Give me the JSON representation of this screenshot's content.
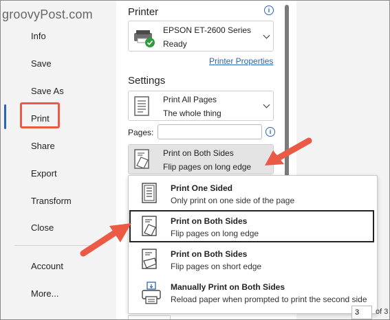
{
  "watermark": "groovyPost.com",
  "nav": {
    "items": [
      "Info",
      "Save",
      "Save As",
      "Print",
      "Share",
      "Export",
      "Transform",
      "Close",
      "Account",
      "More..."
    ],
    "active": "Print"
  },
  "printer": {
    "heading": "Printer",
    "name": "EPSON ET-2600 Series",
    "status": "Ready",
    "properties_link": "Printer Properties"
  },
  "settings": {
    "heading": "Settings",
    "range": {
      "title": "Print All Pages",
      "subtitle": "The whole thing"
    },
    "pages_label": "Pages:",
    "pages_value": "",
    "sides": {
      "title": "Print on Both Sides",
      "subtitle": "Flip pages on long edge"
    }
  },
  "sides_menu": {
    "options": [
      {
        "title": "Print One Sided",
        "subtitle": "Only print on one side of the page",
        "icon": "one-sided-icon"
      },
      {
        "title": "Print on Both Sides",
        "subtitle": "Flip pages on long edge",
        "icon": "long-edge-icon",
        "selected": true
      },
      {
        "title": "Print on Both Sides",
        "subtitle": "Flip pages on short edge",
        "icon": "short-edge-icon"
      },
      {
        "title": "Manually Print on Both Sides",
        "subtitle": "Reload paper when prompted to print the second side",
        "icon": "manual-duplex-icon"
      }
    ]
  },
  "preview": {
    "page": "3",
    "of_text": "of 3"
  },
  "colors": {
    "accent": "#2b63b8",
    "highlight": "#ea5a45",
    "nav_bg": "#f3f3f3"
  }
}
